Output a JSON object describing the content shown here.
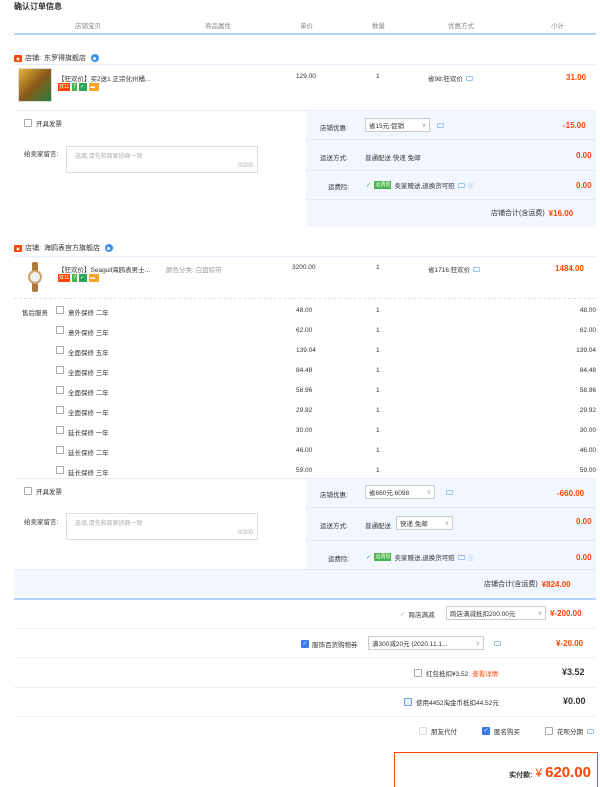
{
  "page_title": "确认订单信息",
  "columns": [
    "店铺宝贝",
    "商品属性",
    "单价",
    "数量",
    "优惠方式",
    "小计"
  ],
  "shop1": {
    "shop_label": "店铺:",
    "shop_name": "东罗得旗舰店",
    "item_title": "【狂欢价】买2送1 正宗化州橘...",
    "tag_double11": "双11",
    "tag_7": "7",
    "unit_price": "129.00",
    "qty": "1",
    "discount": "省98:狂欢价",
    "subtotal": "31.00",
    "invoice": "开具发票",
    "shop_discount_label": "店铺优惠:",
    "shop_discount_value": "省15元:促销",
    "shop_discount_amount": "-15.00",
    "message_label": "给卖家留言:",
    "message_placeholder": "选填,请先和商家协商一致",
    "message_count": "0/200",
    "ship_label": "运送方式:",
    "ship_value": "普通配送 快递 免邮",
    "ship_amount": "0.00",
    "insure_label": "运费险:",
    "insure_tag": "运费险",
    "insure_text": "卖家赠送,退换货可赔",
    "insure_amount": "0.00",
    "total_label": "店铺合计(含运费)",
    "total_value": "¥16.00"
  },
  "shop2": {
    "shop_label": "店铺:",
    "shop_name": "海鸥表官方旗舰店",
    "item_title": "【狂欢价】Seagull海鸥表男士...",
    "attr": "颜色分类: 白盘棕带",
    "tag_double11": "双11",
    "tag_7": "7",
    "unit_price": "3200.00",
    "qty": "1",
    "discount": "省1716:狂欢价",
    "subtotal": "1484.00",
    "service_label": "售后服务",
    "services": [
      {
        "name": "意外保修 二年",
        "price": "48.00",
        "qty": "1",
        "sub": "48.00"
      },
      {
        "name": "意外保修 三年",
        "price": "62.00",
        "qty": "1",
        "sub": "62.00"
      },
      {
        "name": "全面保修 五年",
        "price": "139.04",
        "qty": "1",
        "sub": "139.04"
      },
      {
        "name": "全面保修 三年",
        "price": "84.48",
        "qty": "1",
        "sub": "84.48"
      },
      {
        "name": "全面保修 二年",
        "price": "58.96",
        "qty": "1",
        "sub": "58.96"
      },
      {
        "name": "全面保修 一年",
        "price": "29.92",
        "qty": "1",
        "sub": "29.92"
      },
      {
        "name": "延长保修 一年",
        "price": "30.00",
        "qty": "1",
        "sub": "30.00"
      },
      {
        "name": "延长保修 二年",
        "price": "46.00",
        "qty": "1",
        "sub": "46.00"
      },
      {
        "name": "延长保修 三年",
        "price": "59.00",
        "qty": "1",
        "sub": "59.00"
      }
    ],
    "invoice": "开具发票",
    "shop_discount_label": "店铺优惠:",
    "shop_discount_value": "省660元:6098",
    "shop_discount_amount": "-660.00",
    "message_label": "给卖家留言:",
    "message_placeholder": "选填,请先和商家协商一致",
    "message_count": "0/200",
    "ship_label": "运送方式:",
    "ship_value_prefix": "普通配送",
    "ship_select": "快递 免邮",
    "ship_amount": "0.00",
    "insure_label": "运费险:",
    "insure_tag": "运费险",
    "insure_text": "卖家赠送,退换货可赔",
    "insure_amount": "0.00",
    "total_label": "店铺合计(含运费)",
    "total_value": "¥824.00"
  },
  "summary": {
    "cross_label": "跨店满减",
    "cross_select": "跨店满减抵扣200.00元",
    "cross_amount": "¥-200.00",
    "coupon_label": "服饰百货购物券",
    "coupon_select": "满300减20元 (2020.11.1...",
    "coupon_amount": "¥-20.00",
    "redpack_label": "红包抵扣¥3.52",
    "redpack_link": "查看详情",
    "redpack_amount": "¥3.52",
    "taojin_label": "使用4452淘金币抵扣44.52元",
    "taojin_amount": "¥0.00",
    "friend_pay": "朋友代付",
    "anonymous": "匿名购买",
    "huabei": "花呗分期",
    "pay_label": "实付款:",
    "pay_symbol": "¥",
    "pay_amount": "620.00"
  },
  "colors": {
    "accent_red": "#ff4400",
    "accent_blue": "#3a7ae6",
    "border_blue": "#b2d1ff",
    "panel_blue": "#f2f7ff"
  }
}
